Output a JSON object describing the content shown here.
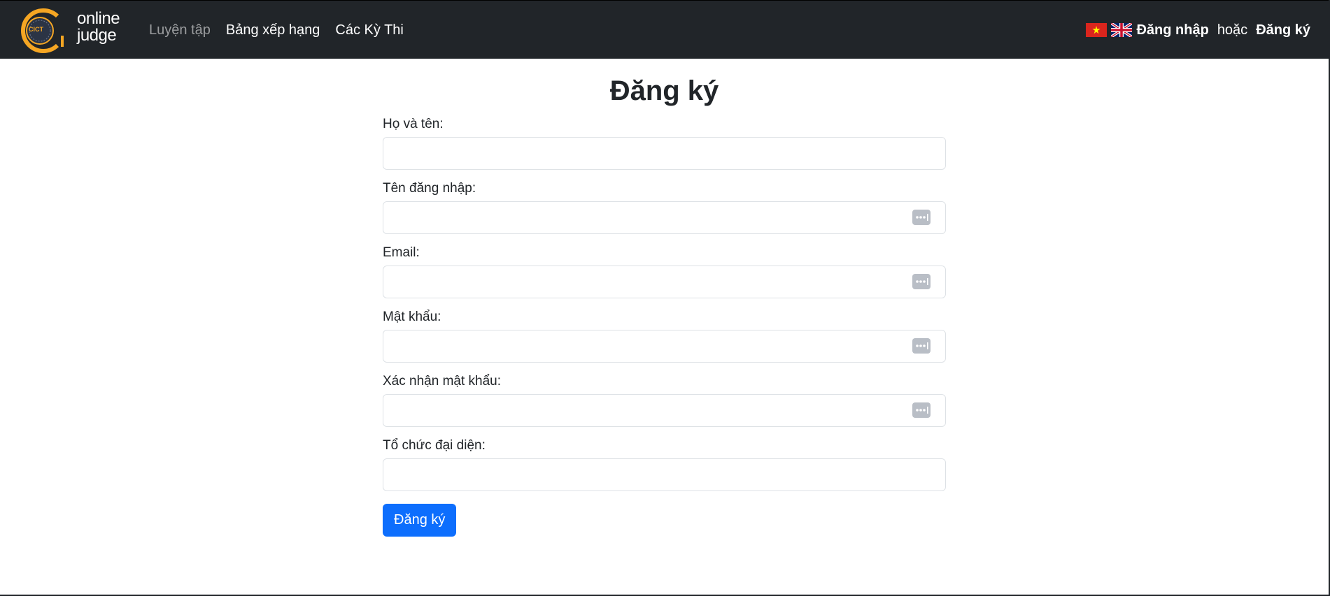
{
  "navbar": {
    "logo": {
      "badge_text": "CICT",
      "line1": "online",
      "line2": "judge"
    },
    "links": [
      {
        "label": "Luyện tập"
      },
      {
        "label": "Bảng xếp hạng"
      },
      {
        "label": "Các Kỳ Thi"
      }
    ],
    "languages": [
      "vi-flag-icon",
      "uk-flag-icon"
    ],
    "login_label": "Đăng nhập",
    "or_label": "hoặc",
    "register_label": "Đăng ký"
  },
  "form": {
    "title": "Đăng ký",
    "fields": [
      {
        "label": "Họ và tên:",
        "value": "",
        "icon": ""
      },
      {
        "label": "Tên đăng nhập:",
        "value": "",
        "icon": "password-manager-icon"
      },
      {
        "label": "Email:",
        "value": "",
        "icon": "password-manager-icon"
      },
      {
        "label": "Mật khẩu:",
        "value": "",
        "icon": "password-manager-icon"
      },
      {
        "label": "Xác nhận mật khẩu:",
        "value": "",
        "icon": "password-manager-icon"
      },
      {
        "label": "Tổ chức đại diện:",
        "value": "",
        "icon": ""
      }
    ],
    "submit_label": "Đăng ký"
  },
  "colors": {
    "navbar_bg": "#212529",
    "primary": "#0d6efd",
    "logo_accent": "#f5a623"
  }
}
